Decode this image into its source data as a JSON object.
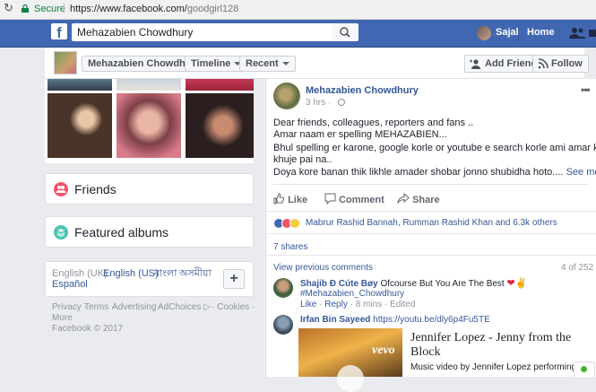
{
  "browser": {
    "secure_label": "Secure",
    "url_host": "https://www.facebook.com/",
    "url_path": "goodgirl128"
  },
  "topbar": {
    "search_value": "Mehazabien Chowdhury",
    "user_name": "Sajal",
    "home_label": "Home",
    "brand_color": "#4267b2"
  },
  "profile_header": {
    "name_button": "Mehazabien Chowdhury",
    "timeline_button": "Timeline",
    "recent_button": "Recent",
    "add_friend_button": "Add Friend",
    "follow_button": "Follow"
  },
  "sidebar": {
    "friends_label": "Friends",
    "albums_label": "Featured albums",
    "languages": {
      "current": "English (UK)",
      "options": [
        "English (US)",
        "বাংলা",
        "অসমীয়া",
        "Español"
      ],
      "add_label": "+"
    },
    "footer": {
      "privacy": "Privacy ·",
      "terms": "Terms ·",
      "advertising": "Advertising ·",
      "adchoices": "AdChoices",
      "cookies": "· Cookies ·",
      "more": "More",
      "copyright": "Facebook © 2017"
    }
  },
  "post": {
    "author": "Mehazabien Chowdhury",
    "time": "3 hrs ·",
    "lines": [
      "Dear friends, colleagues, reporters and fans ..",
      "Amar naam er spelling MEHAZABIEN...",
      "Bhul spelling er karone, google korle or youtube e search korle ami amar kaaj",
      "khuje pai na..",
      "Doya kore banan thik likhle amader shobar jonno shubidha hoto...."
    ],
    "see_more": "See more",
    "actions": {
      "like": "Like",
      "comment": "Comment",
      "share": "Share"
    },
    "reactors": "Mabrur Rashid Bannah, Rumman Rashid Khan and 6.3k others",
    "shares": "7 shares",
    "view_previous": "View previous comments",
    "comment_count": "4 of 252",
    "comments": [
      {
        "name": "Shajib Ð Cúte Bøy",
        "body": "Ofcourse But You Are The Best",
        "hashtag": "#Mehazabien_Chowdhury",
        "like": "Like",
        "reply": "Reply",
        "meta": "· 8 mins · Edited"
      },
      {
        "name": "Irfan Bin Sayeed",
        "link": "https://youtu.be/dly6p4Fu5TE"
      }
    ],
    "video": {
      "title_line1": "Jennifer Lopez - Jenny from the",
      "title_line2": "Block",
      "description": "Music video by Jennifer Lopez performing...",
      "thumb_brand": "vevo"
    }
  }
}
